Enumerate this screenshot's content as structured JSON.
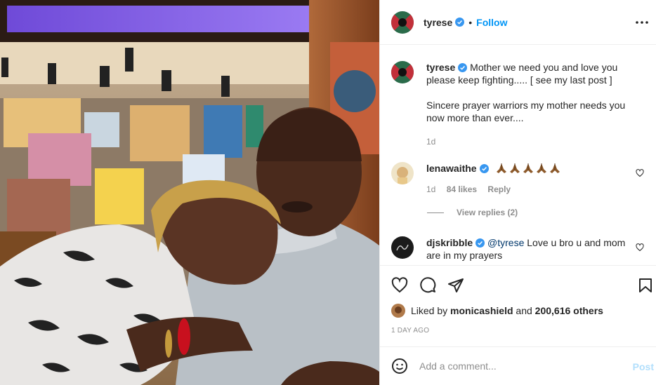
{
  "post": {
    "author": "tyrese",
    "follow_label": "Follow",
    "separator": "•",
    "caption": {
      "username": "tyrese",
      "text_line1": "Mother we need you and love you please keep fighting..... [ see my last post ]",
      "text_line2": "Sincere prayer warriors my mother needs you now more than ever....",
      "time": "1d"
    },
    "comments": [
      {
        "username": "lenawaithe",
        "emojis": [
          "folded-hands",
          "folded-hands",
          "folded-hands",
          "folded-hands",
          "folded-hands"
        ],
        "time": "1d",
        "likes": "84 likes",
        "reply_label": "Reply",
        "view_replies": "View replies (2)"
      },
      {
        "username": "djskribble",
        "mention": "@tyrese",
        "text": " Love u bro u and mom are in my prayers"
      }
    ],
    "liked_by": {
      "prefix": "Liked by ",
      "user": "monicashield",
      "middle": " and ",
      "others": "200,616 others"
    },
    "date": "1 DAY AGO",
    "add_comment": {
      "placeholder": "Add a comment...",
      "post_label": "Post"
    },
    "icons": {
      "like": "heart-icon",
      "comment": "comment-icon",
      "share": "share-icon",
      "save": "bookmark-icon",
      "more": "more-options-icon",
      "emoji": "emoji-icon",
      "verified": "verified-badge-icon"
    },
    "colors": {
      "accent": "#0095f6",
      "verified": "#3897f0",
      "post_disabled": "#b2dffc",
      "muted": "#8e8e8e",
      "text": "#262626"
    }
  }
}
